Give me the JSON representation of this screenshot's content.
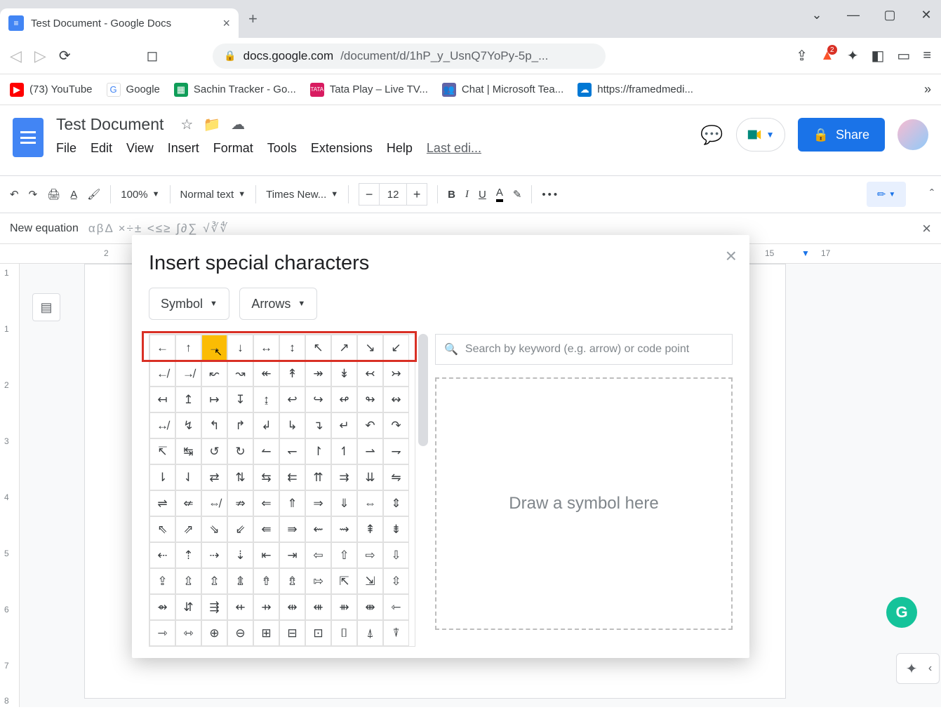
{
  "browser": {
    "tab_title": "Test Document - Google Docs",
    "url_host": "docs.google.com",
    "url_path": "/document/d/1hP_y_UsnQ7YoPy-5p_...",
    "brave_count": "2"
  },
  "bookmarks": [
    {
      "label": "(73) YouTube",
      "color": "#ff0000"
    },
    {
      "label": "Google",
      "color": "#fff"
    },
    {
      "label": "Sachin Tracker - Go...",
      "color": "#0f9d58"
    },
    {
      "label": "Tata Play – Live TV...",
      "color": "#d81b60"
    },
    {
      "label": "Chat | Microsoft Tea...",
      "color": "#6264a7"
    },
    {
      "label": "https://framedmedi...",
      "color": "#0078d4"
    }
  ],
  "docs": {
    "title": "Test Document",
    "last_edit": "Last edi...",
    "menus": [
      "File",
      "Edit",
      "View",
      "Insert",
      "Format",
      "Tools",
      "Extensions",
      "Help"
    ],
    "share_label": "Share"
  },
  "toolbar": {
    "zoom": "100%",
    "style": "Normal text",
    "font": "Times New...",
    "font_size": "12"
  },
  "equation": {
    "label": "New equation",
    "symbols": "αβΔ  ×÷±  <≤≥  ∫∂∑  √∛∜"
  },
  "ruler_h": [
    "2",
    "15",
    "17"
  ],
  "ruler_v": [
    "1",
    "1",
    "2",
    "3",
    "4",
    "5",
    "6",
    "7",
    "8"
  ],
  "dialog": {
    "title": "Insert special characters",
    "category": "Symbol",
    "subcategory": "Arrows",
    "search_placeholder": "Search by keyword (e.g. arrow) or code point",
    "draw_hint": "Draw a symbol here",
    "grid": [
      [
        "←",
        "↑",
        "→",
        "↓",
        "↔",
        "↕",
        "↖",
        "↗",
        "↘",
        "↙"
      ],
      [
        "↚",
        "↛",
        "↜",
        "↝",
        "↞",
        "↟",
        "↠",
        "↡",
        "↢",
        "↣"
      ],
      [
        "↤",
        "↥",
        "↦",
        "↧",
        "↨",
        "↩",
        "↪",
        "↫",
        "↬",
        "↭"
      ],
      [
        "↮",
        "↯",
        "↰",
        "↱",
        "↲",
        "↳",
        "↴",
        "↵",
        "↶",
        "↷"
      ],
      [
        "↸",
        "↹",
        "↺",
        "↻",
        "↼",
        "↽",
        "↾",
        "↿",
        "⇀",
        "⇁"
      ],
      [
        "⇂",
        "⇃",
        "⇄",
        "⇅",
        "⇆",
        "⇇",
        "⇈",
        "⇉",
        "⇊",
        "⇋"
      ],
      [
        "⇌",
        "⇍",
        "⇎",
        "⇏",
        "⇐",
        "⇑",
        "⇒",
        "⇓",
        "⇔",
        "⇕"
      ],
      [
        "⇖",
        "⇗",
        "⇘",
        "⇙",
        "⇚",
        "⇛",
        "⇜",
        "⇝",
        "⇞",
        "⇟"
      ],
      [
        "⇠",
        "⇡",
        "⇢",
        "⇣",
        "⇤",
        "⇥",
        "⇦",
        "⇧",
        "⇨",
        "⇩"
      ],
      [
        "⇪",
        "⇫",
        "⇬",
        "⇭",
        "⇮",
        "⇯",
        "⇰",
        "⇱",
        "⇲",
        "⇳"
      ],
      [
        "⇴",
        "⇵",
        "⇶",
        "⇷",
        "⇸",
        "⇹",
        "⇺",
        "⇻",
        "⇼",
        "⇽"
      ],
      [
        "⇾",
        "⇿",
        "⊕",
        "⊖",
        "⊞",
        "⊟",
        "⊡",
        "⌷",
        "⍋",
        "⍒"
      ]
    ],
    "hovered_index": 2
  }
}
